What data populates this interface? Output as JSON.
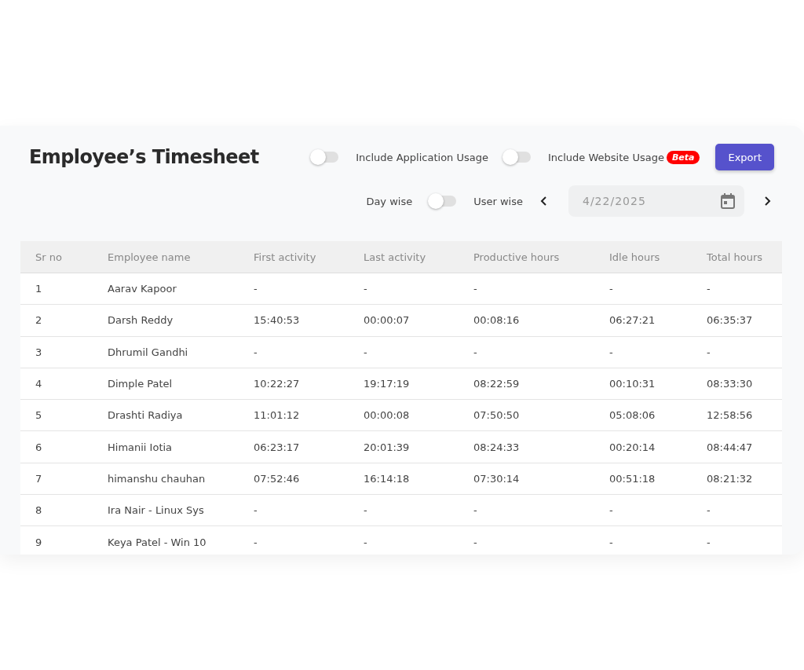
{
  "title": "Employee’s Timesheet",
  "options": [
    {
      "label": "Include Application Usage",
      "on": false
    },
    {
      "label": "Include Website Usage",
      "on": false,
      "badge": "Beta"
    }
  ],
  "export_button": "Export",
  "view_toggle": {
    "left_label": "Day wise",
    "right_label": "User wise",
    "on": false
  },
  "date_field": {
    "placeholder": "4/22/2025"
  },
  "table": {
    "columns": [
      "Sr no",
      "Employee name",
      "First activity",
      "Last activity",
      "Productive hours",
      "Idle hours",
      "Total hours"
    ],
    "rows": [
      [
        "1",
        "Aarav Kapoor",
        "-",
        "-",
        "-",
        "-",
        "-"
      ],
      [
        "2",
        "Darsh Reddy",
        "15:40:53",
        "00:00:07",
        "00:08:16",
        "06:27:21",
        "06:35:37"
      ],
      [
        "3",
        "Dhrumil Gandhi",
        "-",
        "-",
        "-",
        "-",
        "-"
      ],
      [
        "4",
        "Dimple Patel",
        "10:22:27",
        "19:17:19",
        "08:22:59",
        "00:10:31",
        "08:33:30"
      ],
      [
        "5",
        "Drashti Radiya",
        "11:01:12",
        "00:00:08",
        "07:50:50",
        "05:08:06",
        "12:58:56"
      ],
      [
        "6",
        "Himanii Iotia",
        "06:23:17",
        "20:01:39",
        "08:24:33",
        "00:20:14",
        "08:44:47"
      ],
      [
        "7",
        "himanshu chauhan",
        "07:52:46",
        "16:14:18",
        "07:30:14",
        "00:51:18",
        "08:21:32"
      ],
      [
        "8",
        "Ira Nair - Linux Sys",
        "-",
        "-",
        "-",
        "-",
        "-"
      ],
      [
        "9",
        "Keya Patel - Win 10",
        "-",
        "-",
        "-",
        "-",
        "-"
      ]
    ]
  }
}
